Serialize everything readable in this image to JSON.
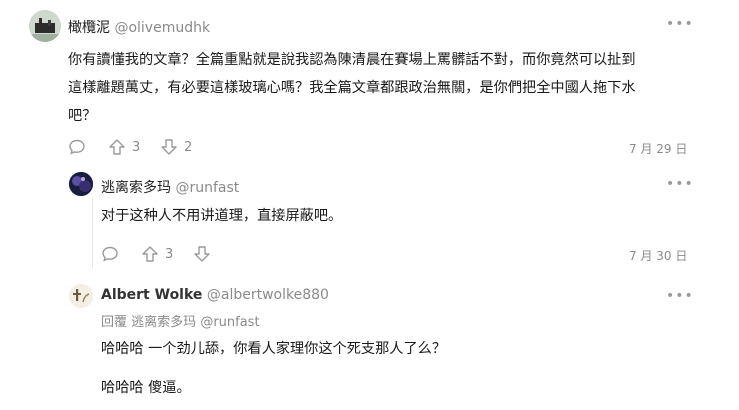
{
  "comment1": {
    "author": "橄欖泥",
    "handle": "@olivemudhk",
    "lines": [
      "你有讀懂我的文章？全篇重點就是說我認為陳清晨在賽場上罵髒話不對，而你竟然可以扯到",
      "這樣離題萬丈，有必要這樣玻璃心嗎？我全篇文章都跟政治無關，是你們把全中國人拖下水",
      "吧？"
    ],
    "upvotes": "3",
    "downvotes": "2",
    "date": "7 月 29 日"
  },
  "comment2": {
    "author": "逃离索多玛",
    "handle": "@runfast",
    "text": "对于这种人不用讲道理，直接屏蔽吧。",
    "upvotes": "3",
    "date": "7 月 30 日"
  },
  "comment3": {
    "author": "Albert Wolke",
    "handle": "@albertwolke880",
    "reply_prefix": "回覆",
    "reply_to_name": "逃离索多玛",
    "reply_to_handle": "@runfast",
    "line1": "哈哈哈 一个劲儿舔，你看人家理你这个死支那人了么？",
    "line2": "哈哈哈 傻逼。"
  },
  "icons": {
    "more": "more-horizontal-icon",
    "reply": "comment-bubble-icon",
    "upvote": "arrow-up-icon",
    "downvote": "arrow-down-icon"
  }
}
